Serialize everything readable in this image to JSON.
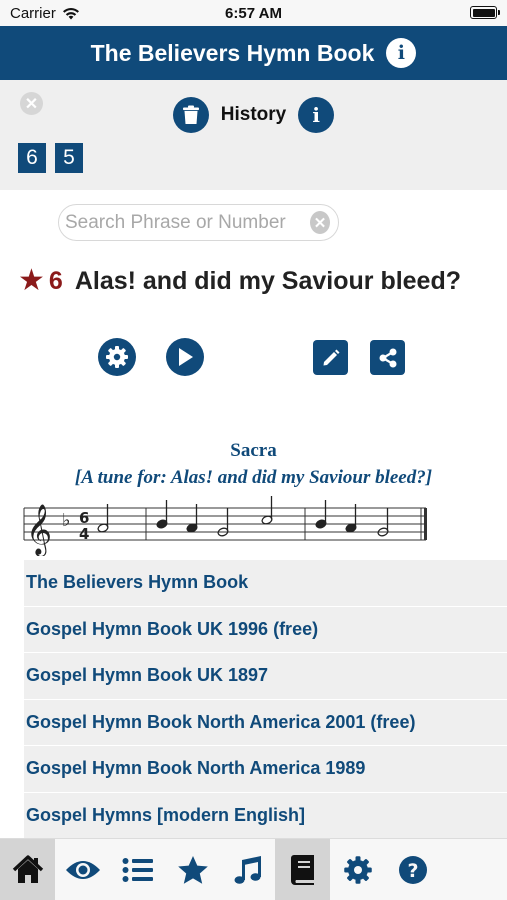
{
  "status_bar": {
    "carrier": "Carrier",
    "time": "6:57 AM"
  },
  "header": {
    "title": "The Believers Hymn Book",
    "info_icon": "info-icon"
  },
  "history": {
    "label": "History",
    "recent": [
      "6",
      "5"
    ]
  },
  "search": {
    "placeholder": "Search Phrase or Number",
    "value": ""
  },
  "hymn": {
    "number": "6",
    "title": "Alas! and did my Saviour bleed?",
    "favorite": true
  },
  "tune": {
    "name": "Sacra",
    "subtitle": "[A tune for: Alas! and did my Saviour bleed?]",
    "time_signature": [
      "6",
      "4"
    ]
  },
  "hymn_books": [
    "The Believers Hymn Book",
    "Gospel Hymn Book UK 1996 (free)",
    "Gospel Hymn Book UK 1897",
    "Gospel Hymn Book North America 2001 (free)",
    "Gospel Hymn Book North America 1989",
    "Gospel Hymns [modern English]"
  ],
  "tabs": [
    "home-icon",
    "eye-icon",
    "list-icon",
    "star-icon",
    "music-note-icon",
    "book-icon",
    "gear-icon",
    "question-icon"
  ],
  "selected_tabs": [
    "home-icon",
    "book-icon"
  ],
  "colors": {
    "brand": "#104a7a",
    "favorite": "#8b1a1a",
    "panel": "#efefef"
  }
}
